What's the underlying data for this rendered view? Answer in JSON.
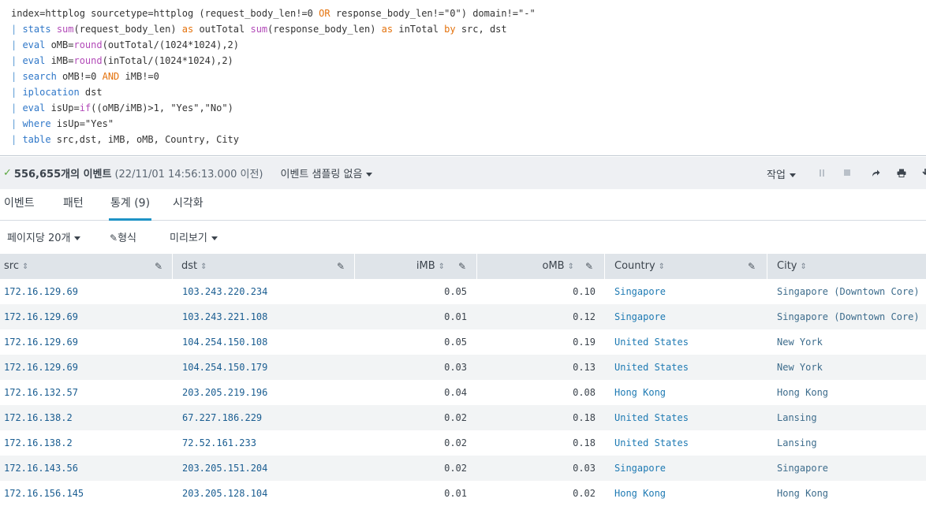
{
  "query": {
    "line1": "index=httplog sourcetype=httplog (request_body_len!=0 ",
    "line1_or": "OR",
    "line1_rest": " response_body_len!=\"0\") domain!=\"-\"",
    "line2": {
      "pipe": "| ",
      "cmd": "stats",
      "sum1": "sum",
      "a1": "(request_body_len) ",
      "as1": "as",
      "a2": " outTotal ",
      "sum2": "sum",
      "a3": "(response_body_len) ",
      "as2": "as",
      "a4": " inTotal ",
      "by": "by",
      "a5": " src, dst"
    },
    "line3": {
      "pipe": "| ",
      "cmd": "eval",
      "a1": " oMB=",
      "fn": "round",
      "a2": "(outTotal/(1024*1024),2)"
    },
    "line4": {
      "pipe": "| ",
      "cmd": "eval",
      "a1": " iMB=",
      "fn": "round",
      "a2": "(inTotal/(1024*1024),2)"
    },
    "line5": {
      "pipe": "| ",
      "cmd": "search",
      "a1": " oMB!=0 ",
      "and": "AND",
      "a2": " iMB!=0"
    },
    "line6": {
      "pipe": "| ",
      "cmd": "iplocation",
      "a1": " dst"
    },
    "line7": {
      "pipe": "| ",
      "cmd": "eval",
      "a1": " isUp=",
      "fn": "if",
      "a2": "((oMB/iMB)>1, \"Yes\",\"No\")"
    },
    "line8": {
      "pipe": "| ",
      "cmd": "where",
      "a1": " isUp=\"Yes\""
    },
    "line9": {
      "pipe": "| ",
      "cmd": "table",
      "a1": " src,dst, iMB, oMB, Country, City"
    }
  },
  "status": {
    "count": "556,655개의 이벤트",
    "time": "(22/11/01 14:56:13.000 이전)",
    "sampling": "이벤트 샘플링 없음",
    "job": "작업"
  },
  "tabs": [
    "이벤트",
    "패턴",
    "통계 (9)",
    "시각화"
  ],
  "options": {
    "per_page": "페이지당 20개",
    "format": "형식",
    "preview": "미리보기"
  },
  "columns": [
    "src",
    "dst",
    "iMB",
    "oMB",
    "Country",
    "City"
  ],
  "rows": [
    {
      "src": "172.16.129.69",
      "dst": "103.243.220.234",
      "iMB": "0.05",
      "oMB": "0.10",
      "country": "Singapore",
      "city": "Singapore (Downtown Core)"
    },
    {
      "src": "172.16.129.69",
      "dst": "103.243.221.108",
      "iMB": "0.01",
      "oMB": "0.12",
      "country": "Singapore",
      "city": "Singapore (Downtown Core)"
    },
    {
      "src": "172.16.129.69",
      "dst": "104.254.150.108",
      "iMB": "0.05",
      "oMB": "0.19",
      "country": "United States",
      "city": "New York"
    },
    {
      "src": "172.16.129.69",
      "dst": "104.254.150.179",
      "iMB": "0.03",
      "oMB": "0.13",
      "country": "United States",
      "city": "New York"
    },
    {
      "src": "172.16.132.57",
      "dst": "203.205.219.196",
      "iMB": "0.04",
      "oMB": "0.08",
      "country": "Hong Kong",
      "city": "Hong Kong"
    },
    {
      "src": "172.16.138.2",
      "dst": "67.227.186.229",
      "iMB": "0.02",
      "oMB": "0.18",
      "country": "United States",
      "city": "Lansing"
    },
    {
      "src": "172.16.138.2",
      "dst": "72.52.161.233",
      "iMB": "0.02",
      "oMB": "0.18",
      "country": "United States",
      "city": "Lansing"
    },
    {
      "src": "172.16.143.56",
      "dst": "203.205.151.204",
      "iMB": "0.02",
      "oMB": "0.03",
      "country": "Singapore",
      "city": "Singapore"
    },
    {
      "src": "172.16.156.145",
      "dst": "203.205.128.104",
      "iMB": "0.01",
      "oMB": "0.02",
      "country": "Hong Kong",
      "city": "Hong Kong"
    }
  ],
  "colors": {
    "accent": "#1e93c6",
    "header_bg": "#dfe4e9",
    "status_bg": "#eef0f3",
    "ok_green": "#5aa63f"
  },
  "icons": {
    "check": "check-icon",
    "pause": "pause-icon",
    "stop": "stop-icon",
    "share": "share-icon",
    "print": "print-icon",
    "pencil": "pencil-icon",
    "sort": "sort-icon"
  }
}
